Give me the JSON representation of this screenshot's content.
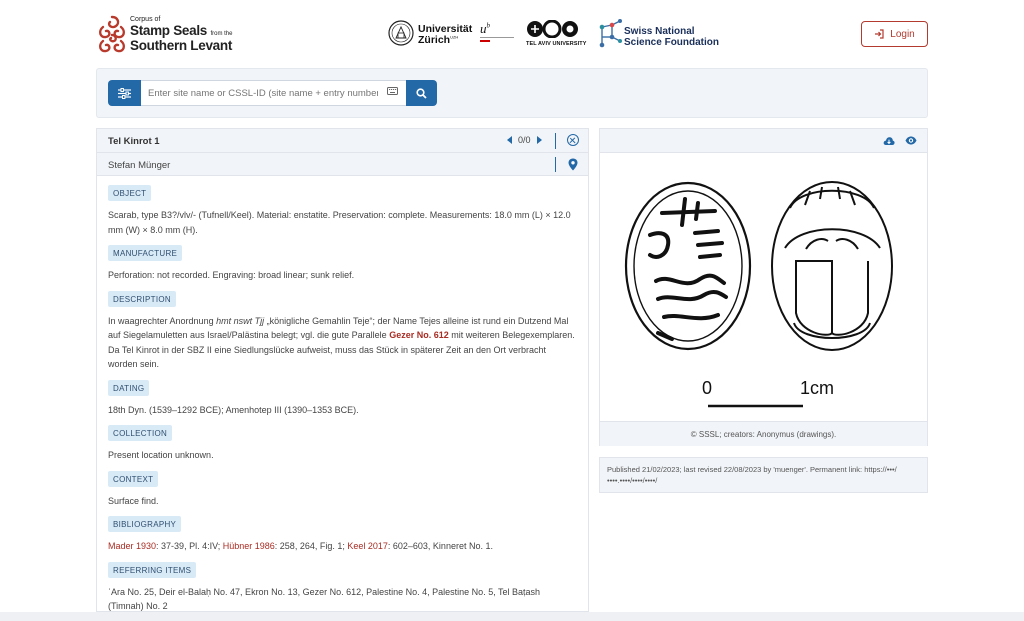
{
  "brand": {
    "line1": "Corpus of",
    "line2": "Stamp Seals",
    "line2_small": "from the",
    "line3": "Southern Levant"
  },
  "partners": {
    "uzh_line1": "Universität",
    "uzh_line2": "Zürich",
    "uzh_sup": "UZH",
    "ub": "u",
    "ub_sup": "b",
    "tau": "TEL AVIV UNIVERSITY",
    "snsf_line1": "Swiss National",
    "snsf_line2": "Science Foundation"
  },
  "login": {
    "label": "Login",
    "icon": "login-icon"
  },
  "search": {
    "placeholder": "Enter site name or CSSL-ID (site name + entry number)",
    "filter_icon": "sliders-icon",
    "keyboard_icon": "keyboard-icon",
    "search_icon": "search-icon"
  },
  "record": {
    "title": "Tel Kinrot 1",
    "pager": "0/0",
    "author": "Stefan Münger",
    "sections": {
      "object": {
        "label": "OBJECT",
        "text": "Scarab, type B3?/vlv/- (Tufnell/Keel). Material: enstatite. Preservation: complete. Measurements: 18.0 mm (L) × 12.0 mm (W) × 8.0 mm (H)."
      },
      "manufacture": {
        "label": "MANUFACTURE",
        "text": "Perforation: not recorded. Engraving: broad linear; sunk relief."
      },
      "description": {
        "label": "DESCRIPTION",
        "text_a": "In waagrechter Anordnung ",
        "text_i": "hmt nswt Tjj",
        "text_b": " „königliche Gemahlin Teje“; der Name Tejes alleine ist rund ein Dutzend Mal auf Siegelamuletten aus Israel/Palästina belegt; vgl. die gute Parallele ",
        "link": "Gezer No. 612",
        "text_c": " mit weiteren Belegexemplaren. Da Tel Kinrot in der SBZ II eine Siedlungslücke aufweist, muss das Stück in späterer Zeit an den Ort verbracht worden sein."
      },
      "dating": {
        "label": "DATING",
        "text": "18th Dyn. (1539–1292 BCE); Amenhotep III (1390–1353 BCE)."
      },
      "collection": {
        "label": "COLLECTION",
        "text": "Present location unknown."
      },
      "context": {
        "label": "CONTEXT",
        "text": "Surface find."
      },
      "bibliography": {
        "label": "BIBLIOGRAPHY",
        "ref1": "Mader 1930",
        "ref1_pages": ": 37-39, Pl. 4:IV; ",
        "ref2": "Hübner 1986",
        "ref2_pages": ": 258, 264, Fig. 1; ",
        "ref3": "Keel 2017",
        "ref3_pages": ": 602–603, Kinneret No. 1."
      },
      "referring": {
        "label": "REFERRING ITEMS",
        "text": "ʿAra No. 25, Deir el-Balaḥ No. 47, Ekron No. 13, Gezer No. 612, Palestine No. 4, Palestine No. 5, Tel Baṭash (Timnah) No. 2"
      }
    }
  },
  "image_panel": {
    "download_icon": "cloud-download-icon",
    "view_icon": "eye-icon",
    "scale_0": "0",
    "scale_1": "1cm",
    "caption": "© SSSL; creators: Anonymus (drawings)."
  },
  "published": {
    "text": "Published 21/02/2023; last revised 22/08/2023 by 'muenger'. Permanent link: https://•••/••••.••••/••••/••••/"
  },
  "colors": {
    "accent": "#2368a7",
    "brand_red": "#a82d24",
    "tag_bg": "#d9eaf7"
  }
}
